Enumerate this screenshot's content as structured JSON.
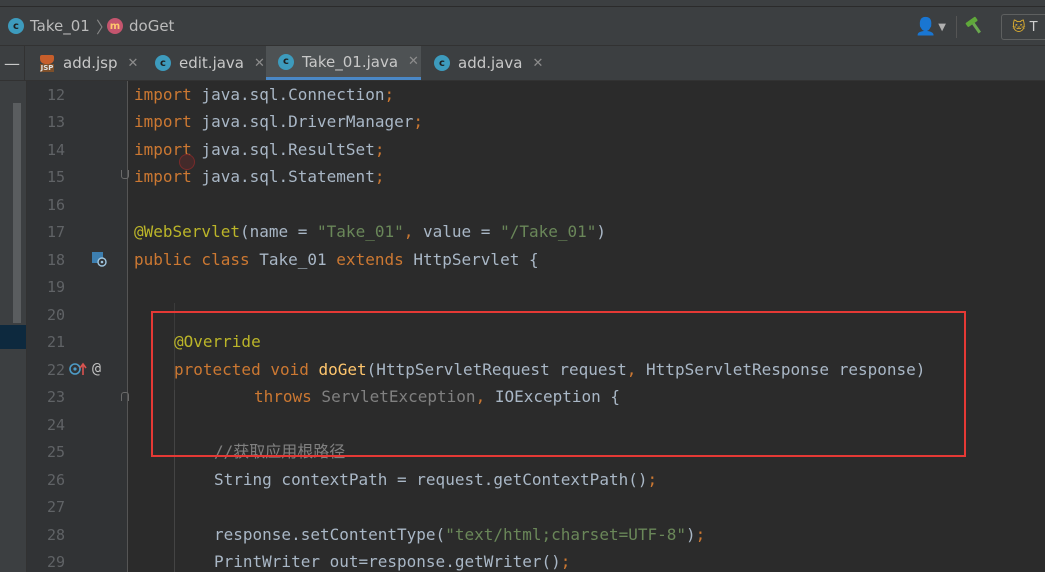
{
  "breadcrumb": {
    "class_name": "Take_01",
    "method_name": "doGet",
    "class_badge": "c",
    "method_badge": "m"
  },
  "toolbar": {
    "run_config_initial": "T"
  },
  "tabs": [
    {
      "label": "add.jsp",
      "icon": "jsp-file-icon",
      "active": false
    },
    {
      "label": "edit.java",
      "icon": "class-icon",
      "active": false
    },
    {
      "label": "Take_01.java",
      "icon": "class-icon",
      "active": true
    },
    {
      "label": "add.java",
      "icon": "class-icon",
      "active": false
    }
  ],
  "gutter": {
    "line_numbers": [
      "12",
      "13",
      "14",
      "15",
      "16",
      "17",
      "18",
      "19",
      "20",
      "21",
      "22",
      "23",
      "24",
      "25",
      "26",
      "27",
      "28",
      "29"
    ],
    "override_marker": "@"
  },
  "code": {
    "l12": {
      "kw": "import",
      "rest": " java.sql.Connection",
      "semi": ";"
    },
    "l13": {
      "kw": "import",
      "rest": " java.sql.DriverManager",
      "semi": ";"
    },
    "l14": {
      "kw": "import",
      "rest": " java.sql.ResultSet",
      "semi": ";"
    },
    "l15": {
      "kw": "import",
      "rest": " java.sql.Statement",
      "semi": ";"
    },
    "l17": {
      "anno": "@WebServlet",
      "p1": "(name = ",
      "s1": "\"Take_01\"",
      "comma": ",",
      "p2": " value = ",
      "s2": "\"/Take_01\"",
      "p3": ")"
    },
    "l18": {
      "kw1": "public class",
      "name": " Take_01 ",
      "kw2": "extends",
      "rest": " HttpServlet {"
    },
    "l21": {
      "anno": "@Override"
    },
    "l22": {
      "kw": "protected void",
      "method": "doGet",
      "p1": "(HttpServletRequest request",
      "comma": ",",
      "p2": " HttpServletResponse response)"
    },
    "l23": {
      "kw": "throws",
      "ex1": " ServletException",
      "comma": ",",
      "ex2": " IOException {"
    },
    "l25": {
      "comment": "//获取应用根路径"
    },
    "l26": {
      "text": "String contextPath = request.getContextPath()",
      "semi": ";"
    },
    "l28": {
      "p1": "response.setContentType(",
      "s1": "\"text/html;charset=UTF-8\"",
      "p2": ")",
      "semi": ";"
    },
    "l29": {
      "text": "PrintWriter out=response.getWriter()",
      "semi": ";"
    }
  },
  "colors": {
    "keyword": "#cc7832",
    "annotation": "#bbb529",
    "string": "#6a8759",
    "method": "#ffc66d",
    "default": "#a9b7c6",
    "comment": "#808080",
    "highlight_box": "#e53935",
    "active_tab_underline": "#4a88c7"
  }
}
